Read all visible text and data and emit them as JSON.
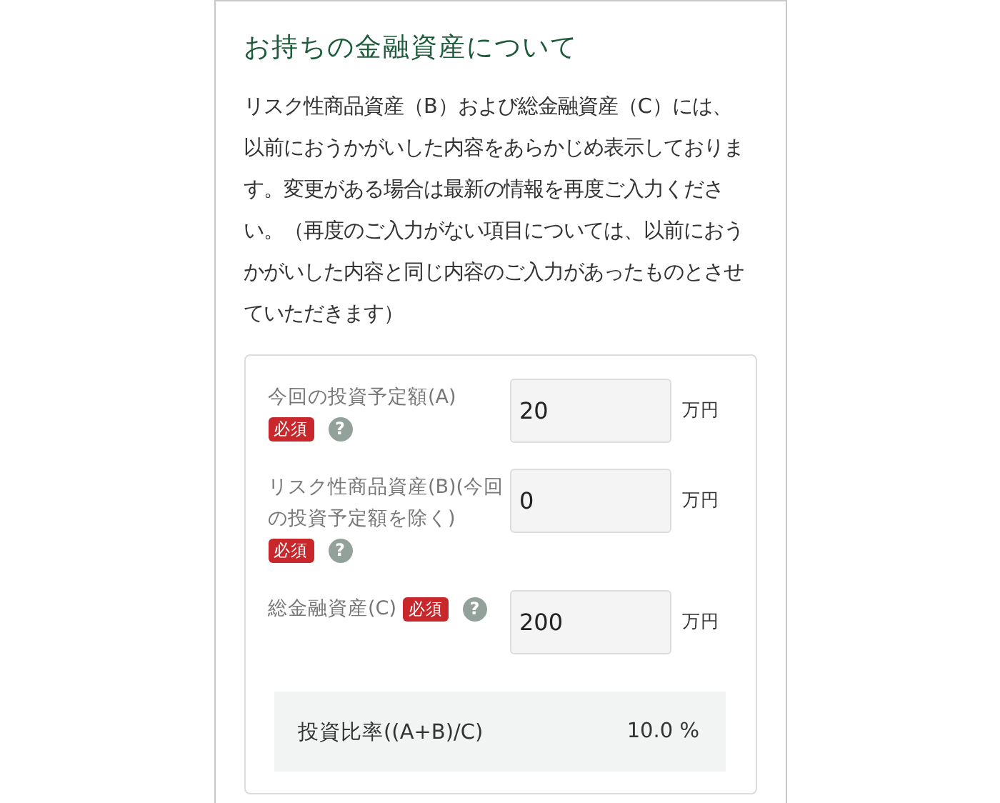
{
  "title": "お持ちの金融資産について",
  "description": "リスク性商品資産（B）および総金融資産（C）には、以前におうかがいした内容をあらかじめ表示しております。変更がある場合は最新の情報を再度ご入力ください。（再度のご入力がない項目については、以前におうかがいした内容と同じ内容のご入力があったものとさせていただきます）",
  "fields": [
    {
      "label": "今回の投資予定額(A)",
      "required": true,
      "required_label": "必須",
      "help": "?",
      "value": "20",
      "unit": "万円"
    },
    {
      "label": "リスク性商品資産(B)(今回の投資予定額を除く)",
      "required": true,
      "required_label": "必須",
      "help": "?",
      "value": "0",
      "unit": "万円"
    },
    {
      "label": "総金融資産(C)",
      "required": true,
      "required_label": "必須",
      "help": "?",
      "value": "200",
      "unit": "万円"
    }
  ],
  "result": {
    "label": "投資比率((A+B)/C)",
    "value": "10.0 %"
  }
}
